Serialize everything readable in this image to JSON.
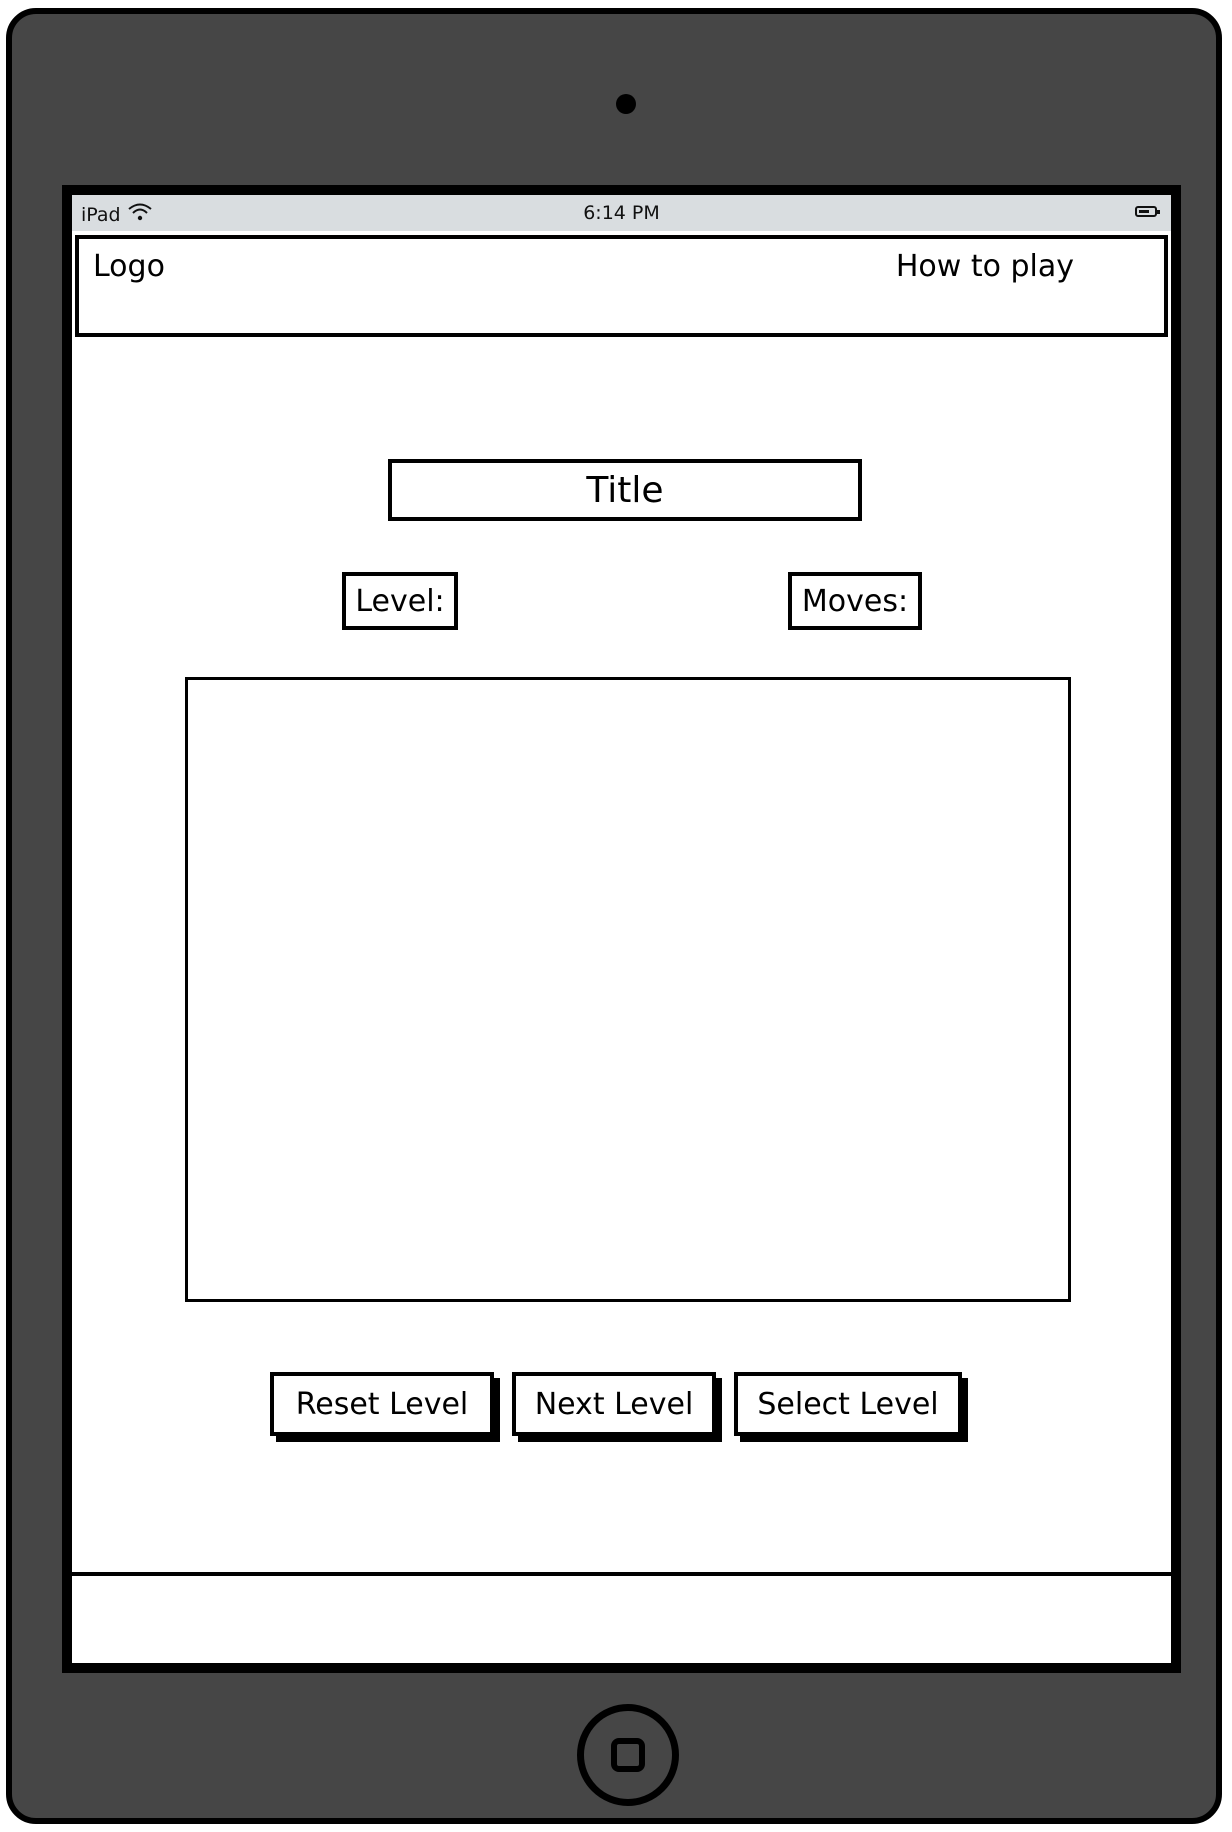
{
  "status_bar": {
    "device": "iPad",
    "time": "6:14 PM",
    "wifi_icon": "wifi-icon",
    "battery_icon": "battery-icon"
  },
  "header": {
    "logo": "Logo",
    "how_to_play": "How to play"
  },
  "main": {
    "title": "Title",
    "level_label": "Level:",
    "moves_label": "Moves:"
  },
  "buttons": {
    "reset": "Reset Level",
    "next": "Next Level",
    "select": "Select Level"
  },
  "colors": {
    "device_frame": "#464646",
    "status_bar": "#d9dde0",
    "ink": "#000000"
  }
}
